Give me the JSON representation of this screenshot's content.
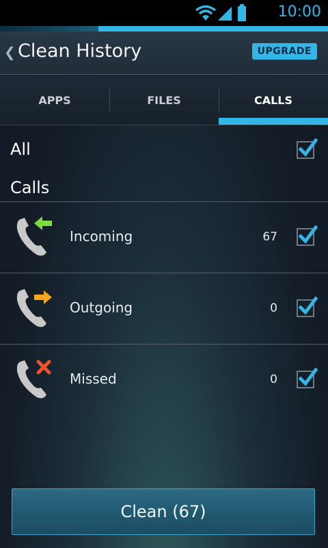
{
  "status_bar": {
    "time": "10:00"
  },
  "header": {
    "back_glyph": "❮",
    "title": "Clean History",
    "upgrade_label": "UPGRADE"
  },
  "tabs": [
    {
      "label": "APPS",
      "selected": false
    },
    {
      "label": "FILES",
      "selected": false
    },
    {
      "label": "CALLS",
      "selected": true
    }
  ],
  "all_row": {
    "label": "All",
    "checked": true
  },
  "section": {
    "label": "Calls"
  },
  "items": [
    {
      "label": "Incoming",
      "count": "67",
      "checked": true,
      "icon": "incoming-call-icon",
      "accent_color": "#7cdc3a"
    },
    {
      "label": "Outgoing",
      "count": "0",
      "checked": true,
      "icon": "outgoing-call-icon",
      "accent_color": "#f5a623"
    },
    {
      "label": "Missed",
      "count": "0",
      "checked": true,
      "icon": "missed-call-icon",
      "accent_color": "#f0532a"
    }
  ],
  "clean_button": {
    "label": "Clean (67)"
  },
  "colors": {
    "accent": "#33b5e5"
  }
}
